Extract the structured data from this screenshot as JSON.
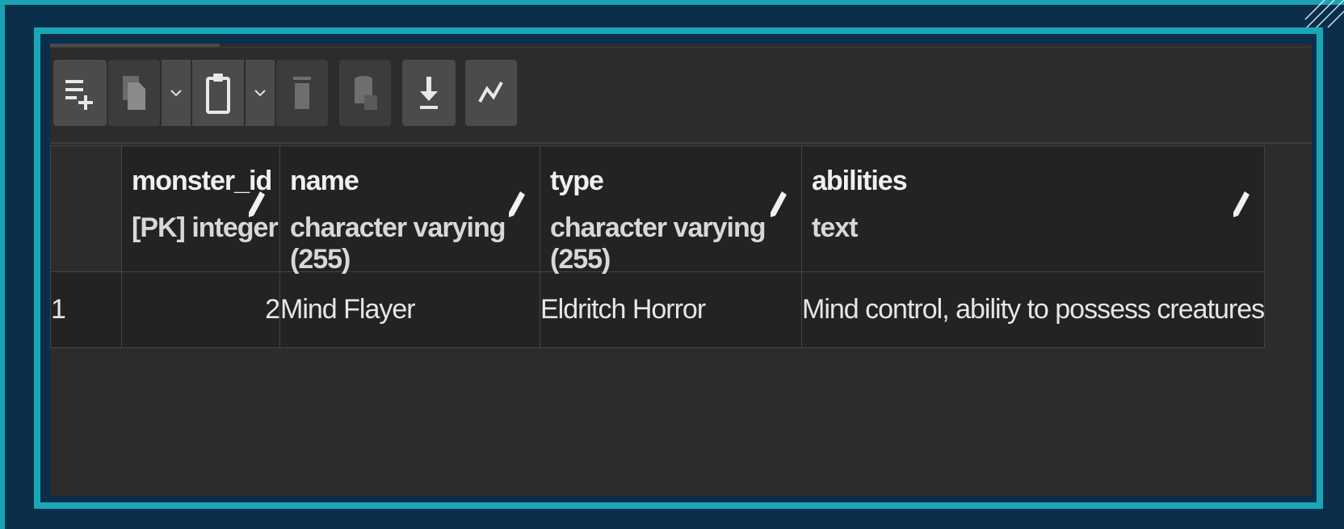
{
  "toolbar": {
    "buttons": [
      {
        "icon": "add-row-icon"
      },
      {
        "icon": "copy-icon"
      },
      {
        "icon": "chevron-down-icon"
      },
      {
        "icon": "paste-icon"
      },
      {
        "icon": "chevron-down-icon"
      },
      {
        "icon": "delete-icon"
      },
      {
        "icon": "save-data-icon"
      },
      {
        "icon": "download-icon"
      },
      {
        "icon": "graph-icon"
      }
    ]
  },
  "table": {
    "columns": [
      {
        "name": "monster_id",
        "type": "[PK] integer"
      },
      {
        "name": "name",
        "type": "character varying (255)"
      },
      {
        "name": "type",
        "type": "character varying (255)"
      },
      {
        "name": "abilities",
        "type": "text"
      }
    ],
    "rows": [
      {
        "row_number": "1",
        "cells": [
          "2",
          "Mind Flayer",
          "Eldritch Horror",
          "Mind control, ability to possess creatures"
        ]
      }
    ]
  },
  "colors": {
    "background": "#0b2e4b",
    "frame_accent": "#1aa7b5",
    "panel": "#2c2c2c",
    "button": "#4b4b4b",
    "text": "#e6e6e6"
  }
}
